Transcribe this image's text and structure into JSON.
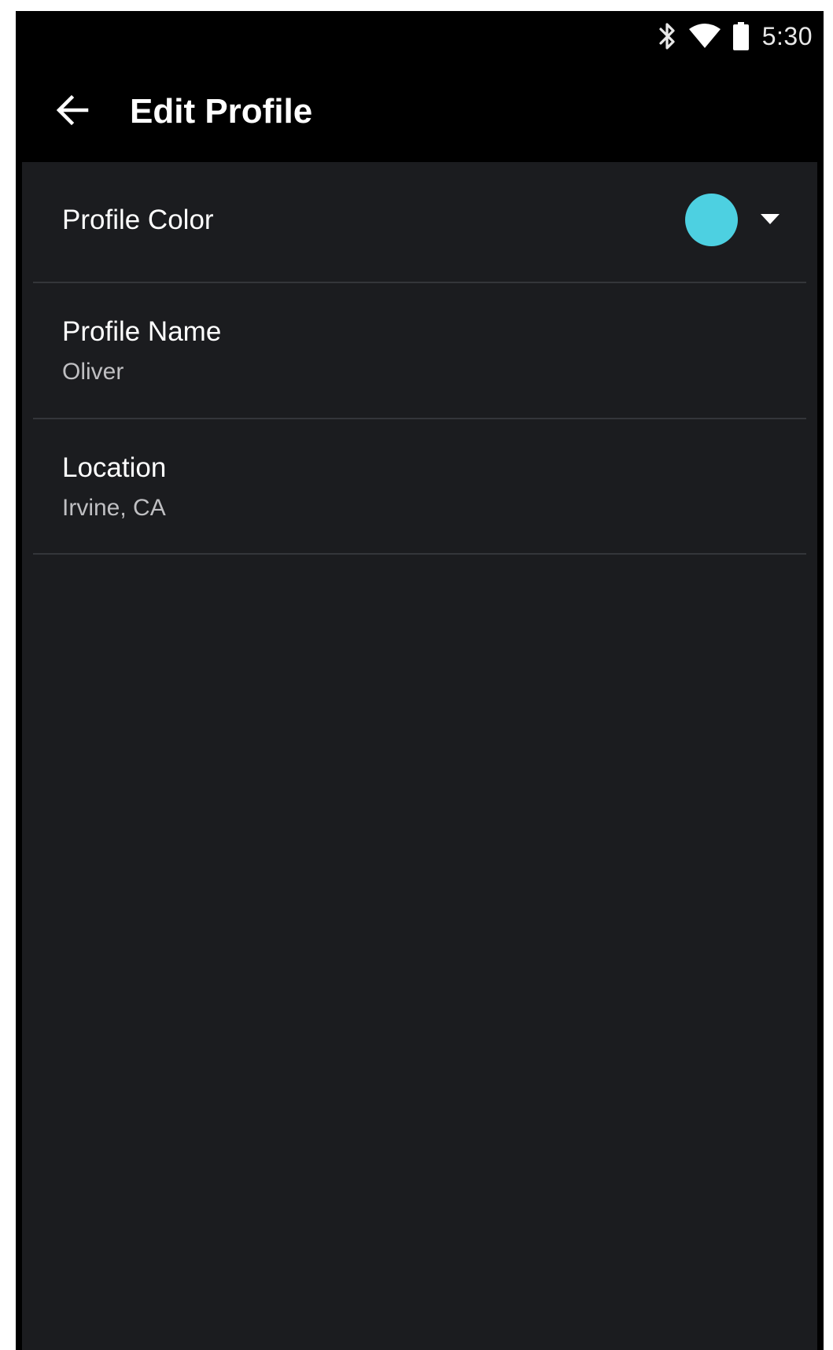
{
  "status_bar": {
    "time": "5:30",
    "icons": [
      "bluetooth-icon",
      "wifi-icon",
      "battery-icon"
    ]
  },
  "app_bar": {
    "back_icon": "arrow-back-icon",
    "title": "Edit Profile"
  },
  "settings": {
    "profile_color": {
      "label": "Profile Color",
      "color": "#4dd0e1",
      "dropdown_icon": "dropdown-arrow-icon"
    },
    "profile_name": {
      "label": "Profile Name",
      "value": "Oliver"
    },
    "location": {
      "label": "Location",
      "value": "Irvine, CA"
    }
  },
  "colors": {
    "status_bar_bg": "#000000",
    "app_bar_bg": "#000000",
    "content_bg": "#1b1c1f",
    "divider": "#34363a",
    "primary_text": "#ffffff",
    "secondary_text": "#bfbfc2"
  }
}
